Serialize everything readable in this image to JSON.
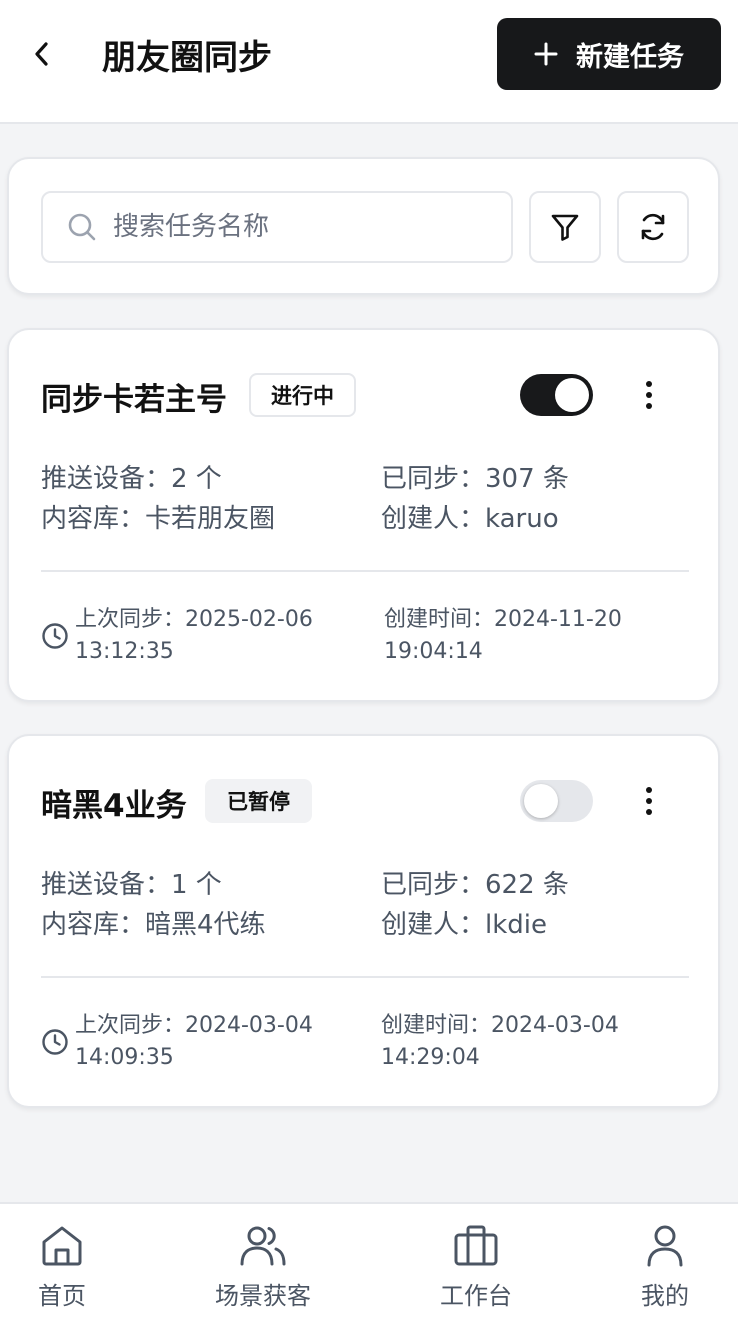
{
  "header": {
    "title": "朋友圈同步",
    "new_task_label": "新建任务"
  },
  "search": {
    "placeholder": "搜索任务名称",
    "value": ""
  },
  "tasks": [
    {
      "name": "同步卡若主号",
      "status": "进行中",
      "enabled": true,
      "devices": "推送设备：2 个",
      "synced": "已同步：307 条",
      "library": "内容库：卡若朋友圈",
      "creator": "创建人：karuo",
      "last_sync_label": "上次同步：2025-02-06",
      "last_sync_time": "13:12:35",
      "created_label": "创建时间：2024-11-20",
      "created_time": "19:04:14"
    },
    {
      "name": "暗黑4业务",
      "status": "已暂停",
      "enabled": false,
      "devices": "推送设备：1 个",
      "synced": "已同步：622 条",
      "library": "内容库：暗黑4代练",
      "creator": "创建人：lkdie",
      "last_sync_label": "上次同步：2024-03-04",
      "last_sync_time": "14:09:35",
      "created_label": "创建时间：2024-03-04",
      "created_time": "14:29:04"
    }
  ],
  "nav": {
    "items": [
      {
        "label": "首页",
        "icon": "home-icon"
      },
      {
        "label": "场景获客",
        "icon": "users-icon"
      },
      {
        "label": "工作台",
        "icon": "briefcase-icon"
      },
      {
        "label": "我的",
        "icon": "user-icon"
      }
    ]
  },
  "colors": {
    "primary": "#17181a",
    "border": "#e5e7eb",
    "text_secondary": "#4b5563"
  }
}
